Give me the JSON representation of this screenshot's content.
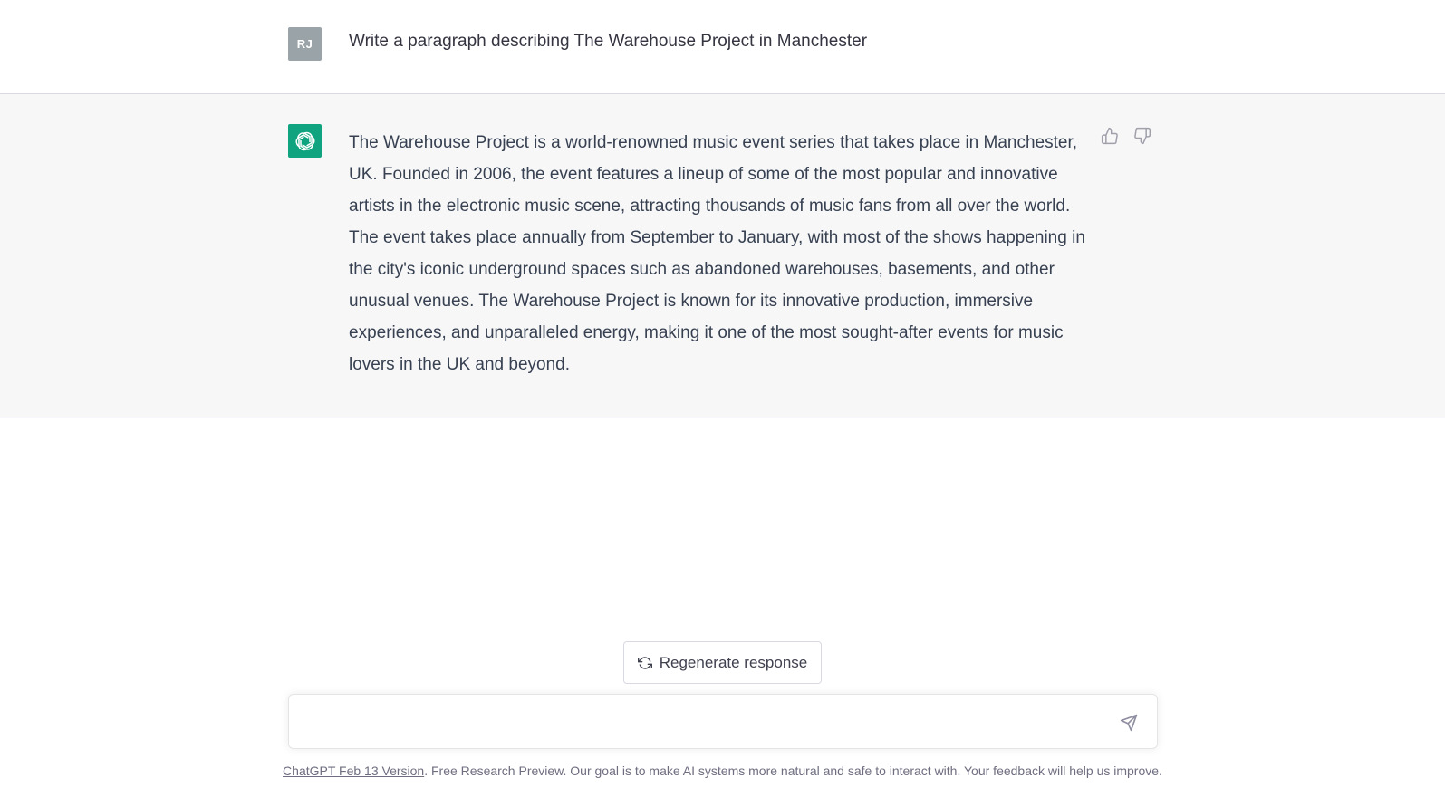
{
  "user_message": {
    "avatar_initials": "RJ",
    "text": "Write a paragraph describing The Warehouse Project in Manchester"
  },
  "assistant_message": {
    "text": "The Warehouse Project is a world-renowned music event series that takes place in Manchester, UK. Founded in 2006, the event features a lineup of some of the most popular and innovative artists in the electronic music scene, attracting thousands of music fans from all over the world. The event takes place annually from September to January, with most of the shows happening in the city's iconic underground spaces such as abandoned warehouses, basements, and other unusual venues. The Warehouse Project is known for its innovative production, immersive experiences, and unparalleled energy, making it one of the most sought-after events for music lovers in the UK and beyond."
  },
  "regenerate": {
    "label": "Regenerate response",
    "icon": "refresh-icon"
  },
  "composer": {
    "value": "",
    "placeholder": "",
    "send_icon": "send-icon"
  },
  "footer": {
    "version_link": "ChatGPT Feb 13 Version",
    "text": ". Free Research Preview. Our goal is to make AI systems more natural and safe to interact with. Your feedback will help us improve."
  },
  "colors": {
    "assistant_avatar": "#10a37f",
    "user_avatar": "#9aa3a8",
    "assistant_bg": "#f7f7f8"
  }
}
